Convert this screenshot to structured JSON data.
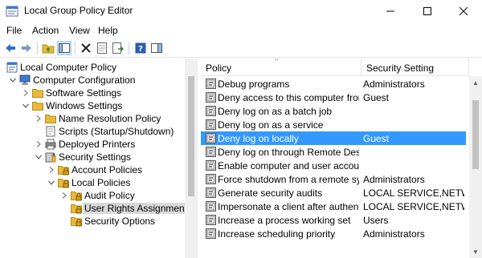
{
  "window": {
    "title": "Local Group Policy Editor",
    "controls": {
      "minimize": "minimize",
      "maximize": "maximize",
      "close": "close"
    }
  },
  "menu": [
    "File",
    "Action",
    "View",
    "Help"
  ],
  "toolbar": {
    "buttons": [
      "back-icon",
      "forward-icon",
      "up-folder-icon",
      "show-hide-tree-icon",
      "delete-icon",
      "properties-icon",
      "export-list-icon",
      "help-icon",
      "show-hide-action-pane-icon"
    ]
  },
  "tree": [
    {
      "label": "Local Computer Policy",
      "level": 0,
      "expander": "",
      "icon": "policy"
    },
    {
      "label": "Computer Configuration",
      "level": 1,
      "expander": "open",
      "icon": "computer"
    },
    {
      "label": "Software Settings",
      "level": 2,
      "expander": "closed",
      "icon": "folder"
    },
    {
      "label": "Windows Settings",
      "level": 2,
      "expander": "open",
      "icon": "folder"
    },
    {
      "label": "Name Resolution Policy",
      "level": 3,
      "expander": "closed",
      "icon": "folder"
    },
    {
      "label": "Scripts (Startup/Shutdown)",
      "level": 3,
      "expander": "",
      "icon": "scripts"
    },
    {
      "label": "Deployed Printers",
      "level": 3,
      "expander": "closed",
      "icon": "printer"
    },
    {
      "label": "Security Settings",
      "level": 3,
      "expander": "open",
      "icon": "security"
    },
    {
      "label": "Account Policies",
      "level": 4,
      "expander": "closed",
      "icon": "lockfolder"
    },
    {
      "label": "Local Policies",
      "level": 4,
      "expander": "open",
      "icon": "lockfolder"
    },
    {
      "label": "Audit Policy",
      "level": 5,
      "expander": "closed",
      "icon": "lockfolder"
    },
    {
      "label": "User Rights Assignment",
      "level": 5,
      "expander": "",
      "icon": "lockfolder",
      "selected": true
    },
    {
      "label": "Security Options",
      "level": 5,
      "expander": "",
      "icon": "lockfolder"
    }
  ],
  "list": {
    "columns": [
      "Policy",
      "Security Setting"
    ],
    "rows": [
      {
        "policy": "Debug programs",
        "setting": "Administrators"
      },
      {
        "policy": "Deny access to this computer from ...",
        "setting": "Guest"
      },
      {
        "policy": "Deny log on as a batch job",
        "setting": ""
      },
      {
        "policy": "Deny log on as a service",
        "setting": ""
      },
      {
        "policy": "Deny log on locally",
        "setting": "Guest",
        "selected": true
      },
      {
        "policy": "Deny log on through Remote Deskt...",
        "setting": ""
      },
      {
        "policy": "Enable computer and user accounts...",
        "setting": ""
      },
      {
        "policy": "Force shutdown from a remote syst...",
        "setting": "Administrators"
      },
      {
        "policy": "Generate security audits",
        "setting": "LOCAL SERVICE,NETW..."
      },
      {
        "policy": "Impersonate a client after authentic...",
        "setting": "LOCAL SERVICE,NETW..."
      },
      {
        "policy": "Increase a process working set",
        "setting": "Users"
      },
      {
        "policy": "Increase scheduling priority",
        "setting": "Administrators"
      }
    ]
  },
  "colors": {
    "selection": "#3399ff",
    "tree_selection": "#d9d9d9",
    "folder": "#e8b93a"
  }
}
